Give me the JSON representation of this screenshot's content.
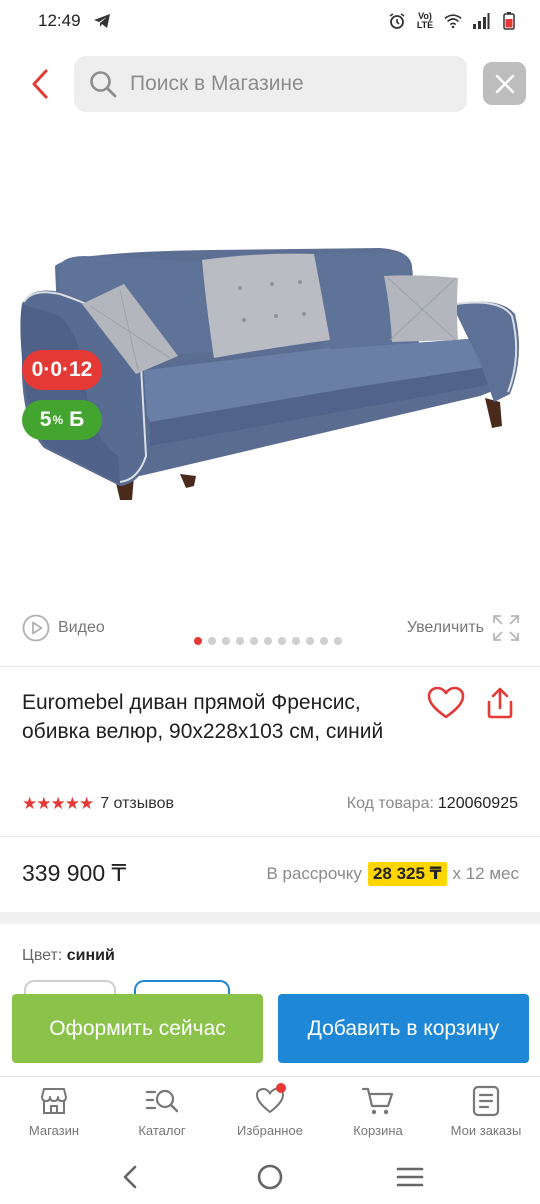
{
  "status_bar": {
    "time": "12:49",
    "network_label_top": "Vo)",
    "network_label_bottom": "LTE"
  },
  "search": {
    "placeholder": "Поиск в Магазине"
  },
  "product": {
    "badges": {
      "installment": "0·0·12",
      "bonus_percent": "5",
      "bonus_sup": "%",
      "bonus_currency": "Б"
    },
    "image_dots": {
      "count": 11,
      "active_index": 0
    },
    "video_label": "Видео",
    "zoom_label": "Увеличить",
    "title": "Euromebel диван прямой Френсис, обивка велюр, 90х228х103 см, синий",
    "rating_stars": "★★★★★",
    "reviews": "7 отзывов",
    "sku_label": "Код товара:",
    "sku_value": "120060925",
    "price": "339 900 ₸",
    "installment_prefix": "В рассрочку",
    "installment_amount": "28 325 ₸",
    "installment_suffix": "x 12 мес",
    "color_label": "Цвет:",
    "color_value": "синий"
  },
  "actions": {
    "buy_now": "Оформить сейчас",
    "add_to_cart": "Добавить в корзину"
  },
  "bottom_nav": {
    "shop": "Магазин",
    "catalog": "Каталог",
    "favorites": "Избранное",
    "cart": "Корзина",
    "orders": "Мои заказы"
  },
  "colors": {
    "accent_red": "#e53935",
    "buy_green": "#8bc34a",
    "cart_blue": "#1e88d6",
    "bonus_green": "#43a52f",
    "installment_yellow": "#ffd600"
  }
}
